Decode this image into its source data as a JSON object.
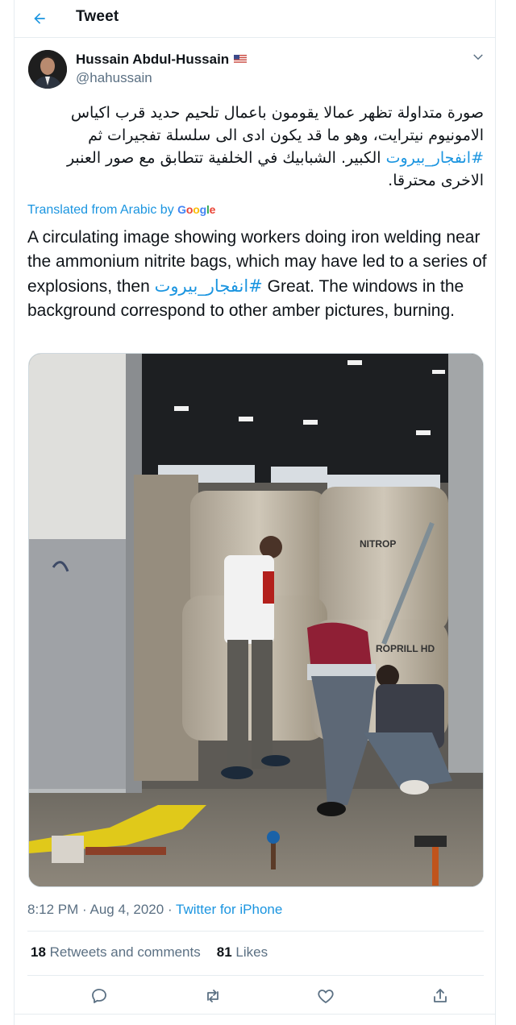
{
  "header": {
    "title": "Tweet",
    "back_icon": "arrow-left-icon"
  },
  "author": {
    "name": "Hussain Abdul-Hussain",
    "handle": "@hahussain",
    "flag_icon": "us-flag-icon"
  },
  "tweet": {
    "arabic_before_tag": "صورة متداولة تظهر عمالا يقومون باعمال تلحيم حديد قرب اكياس الامونيوم نيترايت، وهو ما قد يكون ادى الى سلسلة تفجيرات ثم ",
    "arabic_hashtag": "#انفجار_بيروت",
    "arabic_after_tag": " الكبير. الشبابيك في الخلفية تتطابق مع صور العنبر الاخرى محترقا.",
    "translated_label": "Translated from Arabic by",
    "translated_provider": "Google",
    "english_before_tag": "A circulating image showing workers doing iron welding near the ammonium nitrite bags, which may have led to a series of explosions, then ",
    "english_hashtag": "#انفجار_بيروت",
    "english_after_tag": " Great. The windows in the background correspond to other amber pictures, burning."
  },
  "meta": {
    "time": "8:12 PM",
    "separator": "·",
    "date": "Aug 4, 2020",
    "client": "Twitter for iPhone"
  },
  "stats": {
    "retweets_count": "18",
    "retweets_label": "Retweets and comments",
    "likes_count": "81",
    "likes_label": "Likes"
  },
  "colors": {
    "accent": "#1b95e0",
    "secondary_text": "#5b7083",
    "border": "#e6ecf0"
  }
}
